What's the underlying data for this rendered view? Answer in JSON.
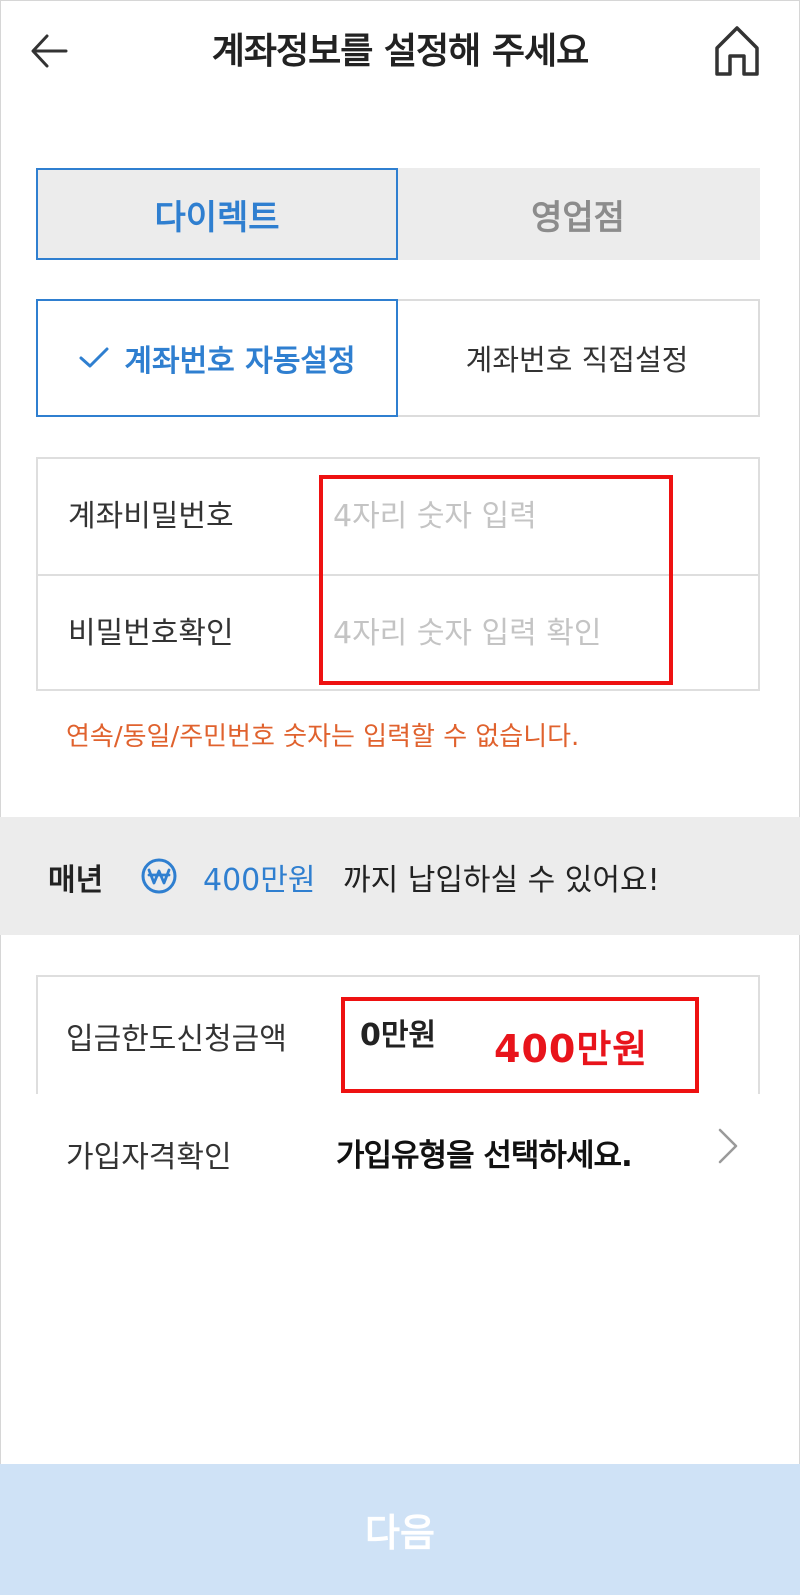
{
  "header": {
    "title": "계좌정보를 설정해 주세요",
    "back_icon": "arrow-left-icon",
    "home_icon": "home-icon"
  },
  "tabs": {
    "direct": "다이렉트",
    "branch": "영업점",
    "selected": "다이렉트"
  },
  "account_options": {
    "auto": "계좌번호 자동설정",
    "manual": "계좌번호 직접설정",
    "selected": "계좌번호 자동설정"
  },
  "password": {
    "label": "계좌비밀번호",
    "placeholder": "4자리 숫자 입력",
    "confirm_label": "비밀번호확인",
    "confirm_placeholder": "4자리 숫자 입력 확인"
  },
  "warning": "연속/동일/주민번호 숫자는 입력할 수 없습니다.",
  "limit_notice": {
    "prefix": "매년",
    "amount": "400만원",
    "suffix": "까지 납입하실 수 있어요!"
  },
  "deposit_limit": {
    "label": "입금한도신청금액",
    "value": "0만원",
    "annotation": "400만원"
  },
  "eligibility": {
    "label": "가입자격확인",
    "value": "가입유형을 선택하세요."
  },
  "next_button": "다음",
  "colors": {
    "accent": "#2f7fd0",
    "warning": "#e0622e",
    "annotation_red": "#ee1111",
    "next_bg": "#cfe2f6"
  }
}
